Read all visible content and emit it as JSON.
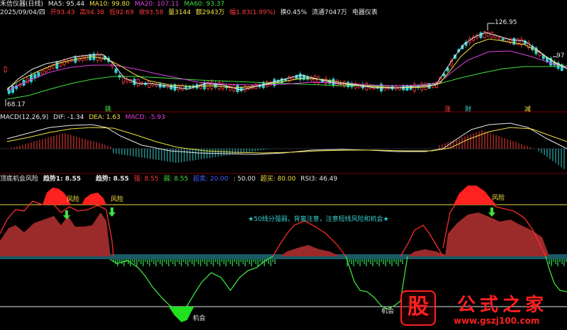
{
  "header1": {
    "name": "禾信仪器(日线)",
    "ma5": "MA5: 95.44",
    "ma10": "MA10: 99.80",
    "ma20": "MA20: 107.11",
    "ma60": "MA60: 93.37"
  },
  "header2": {
    "date": "2025/09/04/四",
    "open": "开93.43",
    "high": "高94.38",
    "low": "低92.69",
    "close": "收93.58",
    "vol": "量3144",
    "amount": "额2943万",
    "change": "幅1.83(1.99%)",
    "turnover": "换0.45%",
    "float": "流通7047万",
    "sector": "电器仪表"
  },
  "price_labels": {
    "high": "126.95",
    "low": "68.17",
    "right": "97"
  },
  "events": [
    "跳",
    "涨",
    "财",
    "减"
  ],
  "macd_header": {
    "name": "MACD(12,26,9)",
    "dif": "DIF: -1.34",
    "dea": "DEA: 1.63",
    "macd": "MACD: -5.93"
  },
  "ind_header": {
    "name": "顶底机会风险",
    "trend1": "趋势1: 8.55",
    "trend": "趋势: 8.55",
    "strong": "强: 8.55",
    "weak": "弱: 8.55",
    "super_sell": "超卖: 20.00",
    "mid": ": 50.00",
    "super_buy": "超买: 80.00",
    "rsi3": "RSI3: 46.49"
  },
  "annotations": {
    "risk1": "风险",
    "risk2": "风险",
    "risk3": "风险",
    "chance1": "机会",
    "chance2": "机会",
    "note": "★50线分强弱，背离注意，注意短线风险和机会★"
  },
  "watermark": {
    "logo": "股",
    "title": "公式之家",
    "url": "www.gszj100.com"
  },
  "colors": {
    "up": "#ff3c3c",
    "down": "#38d0d0",
    "ma5": "#e8e8e8",
    "ma10": "#f0e040",
    "ma20": "#e040e0",
    "ma60": "#40e040"
  }
}
